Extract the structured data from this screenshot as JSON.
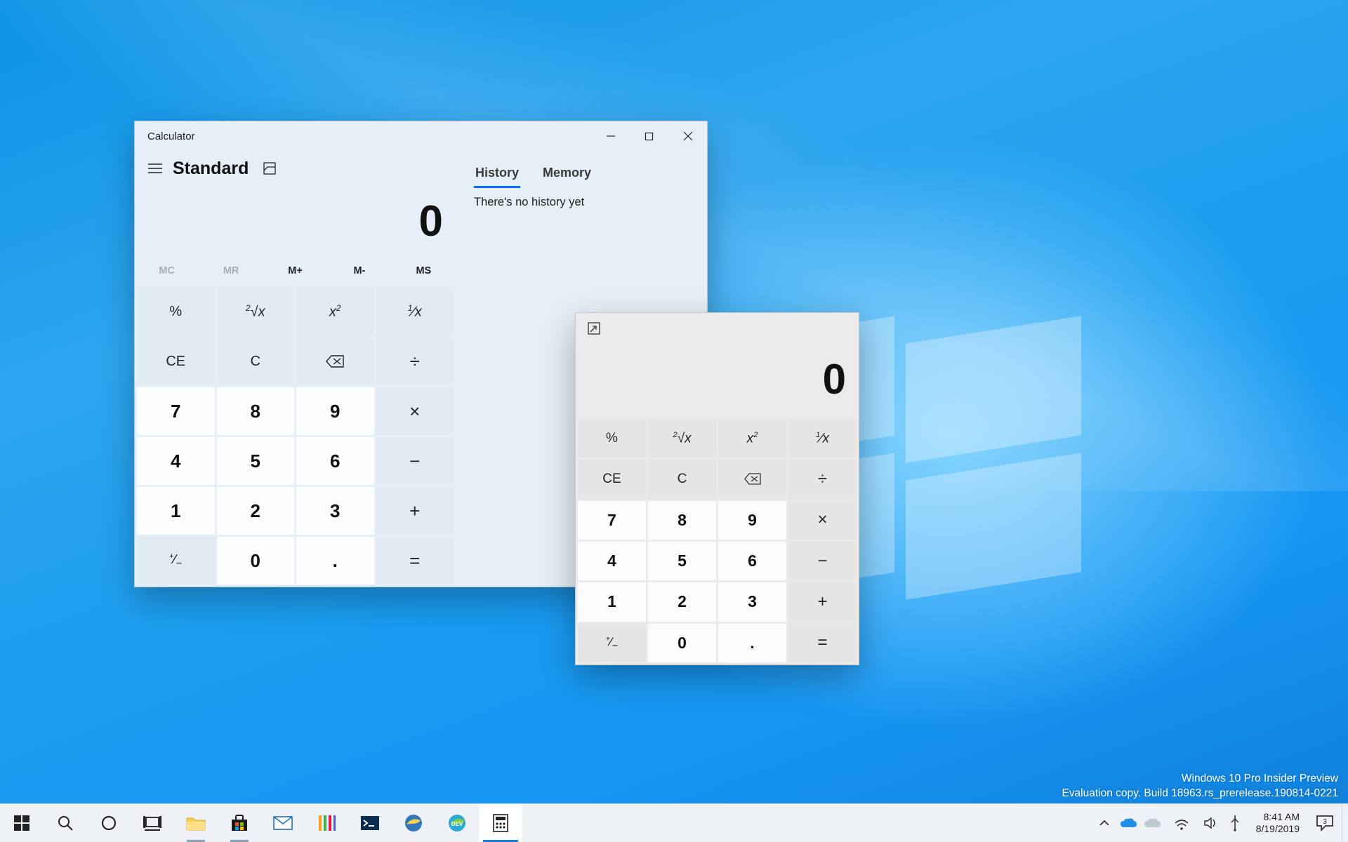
{
  "calc_main": {
    "title": "Calculator",
    "mode": "Standard",
    "tabs": {
      "history": "History",
      "memory": "Memory"
    },
    "no_history": "There's no history yet",
    "display": "0",
    "mem": {
      "mc": "MC",
      "mr": "MR",
      "mplus": "M+",
      "mminus": "M-",
      "ms": "MS"
    },
    "keys": {
      "percent": "%",
      "root": "²√x",
      "square": "x²",
      "recip": "¹⁄x",
      "ce": "CE",
      "c": "C",
      "back": "⌫",
      "div": "÷",
      "k7": "7",
      "k8": "8",
      "k9": "9",
      "mul": "×",
      "k4": "4",
      "k5": "5",
      "k6": "6",
      "sub": "−",
      "k1": "1",
      "k2": "2",
      "k3": "3",
      "add": "+",
      "neg": "⁺⁄₋",
      "k0": "0",
      "dot": ".",
      "eq": "="
    }
  },
  "calc_mini": {
    "display": "0",
    "keys": {
      "percent": "%",
      "root": "²√x",
      "square": "x²",
      "recip": "¹⁄x",
      "ce": "CE",
      "c": "C",
      "back": "⌫",
      "div": "÷",
      "k7": "7",
      "k8": "8",
      "k9": "9",
      "mul": "×",
      "k4": "4",
      "k5": "5",
      "k6": "6",
      "sub": "−",
      "k1": "1",
      "k2": "2",
      "k3": "3",
      "add": "+",
      "neg": "⁺⁄₋",
      "k0": "0",
      "dot": ".",
      "eq": "="
    }
  },
  "watermark": {
    "line1": "Windows 10 Pro Insider Preview",
    "line2": "Evaluation copy. Build 18963.rs_prerelease.190814-0221"
  },
  "tray": {
    "time": "8:41 AM",
    "date": "8/19/2019",
    "notif_count": "3"
  }
}
